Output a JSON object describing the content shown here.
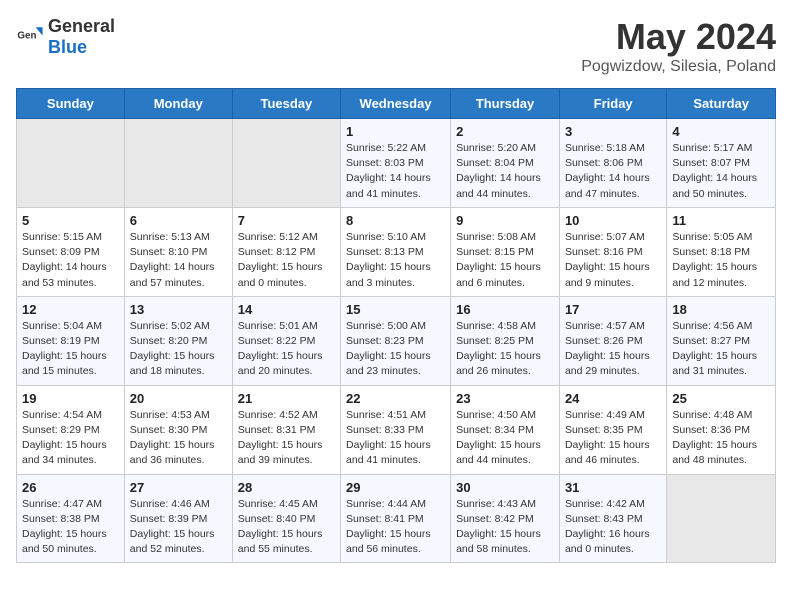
{
  "header": {
    "logo_general": "General",
    "logo_blue": "Blue",
    "title": "May 2024",
    "subtitle": "Pogwizdow, Silesia, Poland"
  },
  "columns": [
    "Sunday",
    "Monday",
    "Tuesday",
    "Wednesday",
    "Thursday",
    "Friday",
    "Saturday"
  ],
  "weeks": [
    [
      {
        "day": "",
        "info": ""
      },
      {
        "day": "",
        "info": ""
      },
      {
        "day": "",
        "info": ""
      },
      {
        "day": "1",
        "info": "Sunrise: 5:22 AM\nSunset: 8:03 PM\nDaylight: 14 hours and 41 minutes."
      },
      {
        "day": "2",
        "info": "Sunrise: 5:20 AM\nSunset: 8:04 PM\nDaylight: 14 hours and 44 minutes."
      },
      {
        "day": "3",
        "info": "Sunrise: 5:18 AM\nSunset: 8:06 PM\nDaylight: 14 hours and 47 minutes."
      },
      {
        "day": "4",
        "info": "Sunrise: 5:17 AM\nSunset: 8:07 PM\nDaylight: 14 hours and 50 minutes."
      }
    ],
    [
      {
        "day": "5",
        "info": "Sunrise: 5:15 AM\nSunset: 8:09 PM\nDaylight: 14 hours and 53 minutes."
      },
      {
        "day": "6",
        "info": "Sunrise: 5:13 AM\nSunset: 8:10 PM\nDaylight: 14 hours and 57 minutes."
      },
      {
        "day": "7",
        "info": "Sunrise: 5:12 AM\nSunset: 8:12 PM\nDaylight: 15 hours and 0 minutes."
      },
      {
        "day": "8",
        "info": "Sunrise: 5:10 AM\nSunset: 8:13 PM\nDaylight: 15 hours and 3 minutes."
      },
      {
        "day": "9",
        "info": "Sunrise: 5:08 AM\nSunset: 8:15 PM\nDaylight: 15 hours and 6 minutes."
      },
      {
        "day": "10",
        "info": "Sunrise: 5:07 AM\nSunset: 8:16 PM\nDaylight: 15 hours and 9 minutes."
      },
      {
        "day": "11",
        "info": "Sunrise: 5:05 AM\nSunset: 8:18 PM\nDaylight: 15 hours and 12 minutes."
      }
    ],
    [
      {
        "day": "12",
        "info": "Sunrise: 5:04 AM\nSunset: 8:19 PM\nDaylight: 15 hours and 15 minutes."
      },
      {
        "day": "13",
        "info": "Sunrise: 5:02 AM\nSunset: 8:20 PM\nDaylight: 15 hours and 18 minutes."
      },
      {
        "day": "14",
        "info": "Sunrise: 5:01 AM\nSunset: 8:22 PM\nDaylight: 15 hours and 20 minutes."
      },
      {
        "day": "15",
        "info": "Sunrise: 5:00 AM\nSunset: 8:23 PM\nDaylight: 15 hours and 23 minutes."
      },
      {
        "day": "16",
        "info": "Sunrise: 4:58 AM\nSunset: 8:25 PM\nDaylight: 15 hours and 26 minutes."
      },
      {
        "day": "17",
        "info": "Sunrise: 4:57 AM\nSunset: 8:26 PM\nDaylight: 15 hours and 29 minutes."
      },
      {
        "day": "18",
        "info": "Sunrise: 4:56 AM\nSunset: 8:27 PM\nDaylight: 15 hours and 31 minutes."
      }
    ],
    [
      {
        "day": "19",
        "info": "Sunrise: 4:54 AM\nSunset: 8:29 PM\nDaylight: 15 hours and 34 minutes."
      },
      {
        "day": "20",
        "info": "Sunrise: 4:53 AM\nSunset: 8:30 PM\nDaylight: 15 hours and 36 minutes."
      },
      {
        "day": "21",
        "info": "Sunrise: 4:52 AM\nSunset: 8:31 PM\nDaylight: 15 hours and 39 minutes."
      },
      {
        "day": "22",
        "info": "Sunrise: 4:51 AM\nSunset: 8:33 PM\nDaylight: 15 hours and 41 minutes."
      },
      {
        "day": "23",
        "info": "Sunrise: 4:50 AM\nSunset: 8:34 PM\nDaylight: 15 hours and 44 minutes."
      },
      {
        "day": "24",
        "info": "Sunrise: 4:49 AM\nSunset: 8:35 PM\nDaylight: 15 hours and 46 minutes."
      },
      {
        "day": "25",
        "info": "Sunrise: 4:48 AM\nSunset: 8:36 PM\nDaylight: 15 hours and 48 minutes."
      }
    ],
    [
      {
        "day": "26",
        "info": "Sunrise: 4:47 AM\nSunset: 8:38 PM\nDaylight: 15 hours and 50 minutes."
      },
      {
        "day": "27",
        "info": "Sunrise: 4:46 AM\nSunset: 8:39 PM\nDaylight: 15 hours and 52 minutes."
      },
      {
        "day": "28",
        "info": "Sunrise: 4:45 AM\nSunset: 8:40 PM\nDaylight: 15 hours and 55 minutes."
      },
      {
        "day": "29",
        "info": "Sunrise: 4:44 AM\nSunset: 8:41 PM\nDaylight: 15 hours and 56 minutes."
      },
      {
        "day": "30",
        "info": "Sunrise: 4:43 AM\nSunset: 8:42 PM\nDaylight: 15 hours and 58 minutes."
      },
      {
        "day": "31",
        "info": "Sunrise: 4:42 AM\nSunset: 8:43 PM\nDaylight: 16 hours and 0 minutes."
      },
      {
        "day": "",
        "info": ""
      }
    ]
  ]
}
